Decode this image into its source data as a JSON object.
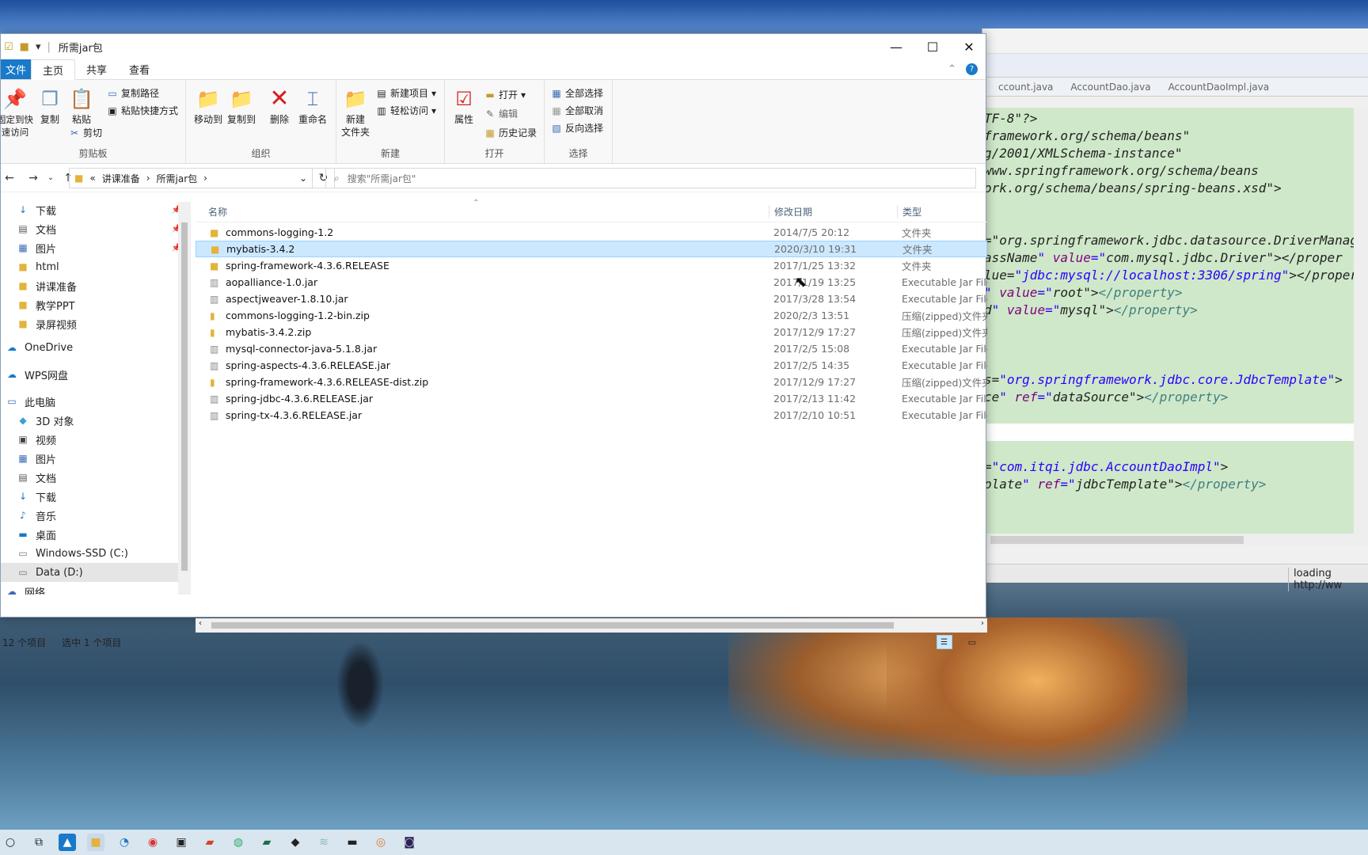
{
  "explorer": {
    "title": "所需jar包",
    "menu": {
      "file": "文件",
      "tabs": [
        "主页",
        "共享",
        "查看"
      ]
    },
    "ribbon": {
      "clipboard": {
        "label": "剪贴板",
        "pin": "固定到快速访问",
        "copy": "复制",
        "paste": "粘贴",
        "copy_path": "复制路径",
        "paste_shortcut": "粘贴快捷方式",
        "cut": "剪切"
      },
      "organize": {
        "label": "组织",
        "move_to": "移动到",
        "copy_to": "复制到",
        "delete": "删除",
        "rename": "重命名"
      },
      "new": {
        "label": "新建",
        "new_folder": "新建\n文件夹",
        "new_item": "新建项目",
        "easy_access": "轻松访问"
      },
      "open": {
        "label": "打开",
        "properties": "属性",
        "open": "打开",
        "edit": "编辑",
        "history": "历史记录"
      },
      "select": {
        "label": "选择",
        "select_all": "全部选择",
        "select_none": "全部取消",
        "invert": "反向选择"
      }
    },
    "breadcrumb": {
      "prefix": "«",
      "parts": [
        "讲课准备",
        "所需jar包"
      ]
    },
    "search_placeholder": "搜索\"所需jar包\"",
    "nav": [
      {
        "label": "下载",
        "icon": "download-icon",
        "pinned": true
      },
      {
        "label": "文档",
        "icon": "document-icon",
        "pinned": true
      },
      {
        "label": "图片",
        "icon": "picture-icon",
        "pinned": true
      },
      {
        "label": "html",
        "icon": "folder-icon"
      },
      {
        "label": "讲课准备",
        "icon": "folder-icon"
      },
      {
        "label": "教学PPT",
        "icon": "folder-icon"
      },
      {
        "label": "录屏视频",
        "icon": "folder-icon"
      },
      {
        "label": "OneDrive",
        "icon": "cloud-icon"
      },
      {
        "label": "WPS网盘",
        "icon": "cloud-icon"
      },
      {
        "label": "此电脑",
        "icon": "computer-icon"
      },
      {
        "label": "3D 对象",
        "icon": "cube-icon"
      },
      {
        "label": "视频",
        "icon": "video-icon"
      },
      {
        "label": "图片",
        "icon": "picture-icon"
      },
      {
        "label": "文档",
        "icon": "document-icon"
      },
      {
        "label": "下载",
        "icon": "download-icon"
      },
      {
        "label": "音乐",
        "icon": "music-icon"
      },
      {
        "label": "桌面",
        "icon": "desktop-icon"
      },
      {
        "label": "Windows-SSD (C:)",
        "icon": "drive-icon"
      },
      {
        "label": "Data (D:)",
        "icon": "drive-icon",
        "selected": true
      },
      {
        "label": "网络",
        "icon": "network-icon"
      }
    ],
    "columns": {
      "name": "名称",
      "date": "修改日期",
      "type": "类型"
    },
    "files": [
      {
        "name": "commons-logging-1.2",
        "date": "2014/7/5 20:12",
        "type": "文件夹",
        "icon": "folder-icon"
      },
      {
        "name": "mybatis-3.4.2",
        "date": "2020/3/10 19:31",
        "type": "文件夹",
        "icon": "folder-icon",
        "selected": true
      },
      {
        "name": "spring-framework-4.3.6.RELEASE",
        "date": "2017/1/25 13:32",
        "type": "文件夹",
        "icon": "folder-icon"
      },
      {
        "name": "aopalliance-1.0.jar",
        "date": "2017/1/19 13:25",
        "type": "Executable Jar File",
        "icon": "jar-icon"
      },
      {
        "name": "aspectjweaver-1.8.10.jar",
        "date": "2017/3/28 13:54",
        "type": "Executable Jar File",
        "icon": "jar-icon"
      },
      {
        "name": "commons-logging-1.2-bin.zip",
        "date": "2020/2/3 13:51",
        "type": "压缩(zipped)文件夹",
        "icon": "zip-icon"
      },
      {
        "name": "mybatis-3.4.2.zip",
        "date": "2017/12/9 17:27",
        "type": "压缩(zipped)文件夹",
        "icon": "zip-icon"
      },
      {
        "name": "mysql-connector-java-5.1.8.jar",
        "date": "2017/2/5 15:08",
        "type": "Executable Jar File",
        "icon": "jar-icon"
      },
      {
        "name": "spring-aspects-4.3.6.RELEASE.jar",
        "date": "2017/2/5 14:35",
        "type": "Executable Jar File",
        "icon": "jar-icon"
      },
      {
        "name": "spring-framework-4.3.6.RELEASE-dist.zip",
        "date": "2017/12/9 17:27",
        "type": "压缩(zipped)文件夹",
        "icon": "zip-icon"
      },
      {
        "name": "spring-jdbc-4.3.6.RELEASE.jar",
        "date": "2017/2/13 11:42",
        "type": "Executable Jar File",
        "icon": "jar-icon"
      },
      {
        "name": "spring-tx-4.3.6.RELEASE.jar",
        "date": "2017/2/10 10:51",
        "type": "Executable Jar File",
        "icon": "jar-icon"
      }
    ],
    "status": {
      "count": "12 个项目",
      "selected": "选中 1 个项目"
    }
  },
  "eclipse": {
    "tabs": [
      "ccount.java",
      "AccountDao.java",
      "AccountDaoImpl.java"
    ],
    "code_lines": [
      "TF-8\"?>",
      "framework.org/schema/beans\"",
      "g/2001/XMLSchema-instance\"",
      "www.springframework.org/schema/beans",
      "ork.org/schema/beans/spring-beans.xsd\">",
      "",
      "",
      "=\"org.springframework.jdbc.datasource.DriverManag",
      "assName\" value=\"com.mysql.jdbc.Driver\"></proper",
      "lue=\"jdbc:mysql://localhost:3306/spring\"></proper",
      "\" value=\"root\"></property>",
      "d\" value=\"mysql\"></property>",
      "",
      "",
      "",
      "s=\"org.springframework.jdbc.core.JdbcTemplate\">",
      "ce\" ref=\"dataSource\"></property>",
      "",
      "",
      "",
      "=\"com.itqi.jdbc.AccountDaoImpl\">",
      "plate\" ref=\"jdbcTemplate\"></property>"
    ],
    "status": "loading http://ww"
  }
}
